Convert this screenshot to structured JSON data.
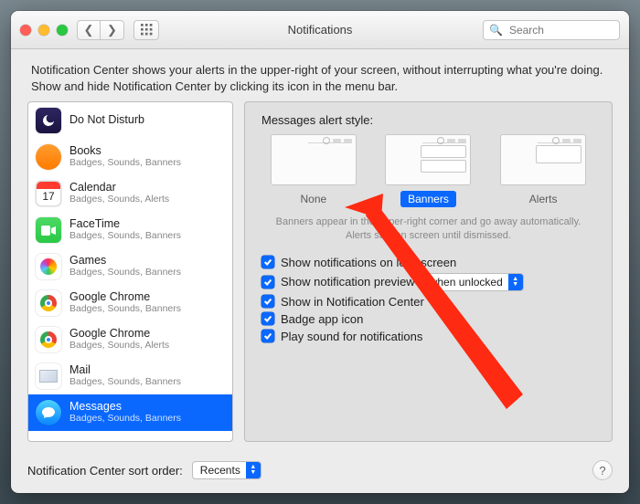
{
  "window": {
    "title": "Notifications"
  },
  "search": {
    "placeholder": "Search"
  },
  "intro": "Notification Center shows your alerts in the upper-right of your screen, without interrupting what you're doing. Show and hide Notification Center by clicking its icon in the menu bar.",
  "sidebar": {
    "items": [
      {
        "name": "Do Not Disturb",
        "sub": ""
      },
      {
        "name": "Books",
        "sub": "Badges, Sounds, Banners"
      },
      {
        "name": "Calendar",
        "sub": "Badges, Sounds, Alerts"
      },
      {
        "name": "FaceTime",
        "sub": "Badges, Sounds, Banners"
      },
      {
        "name": "Games",
        "sub": "Badges, Sounds, Banners"
      },
      {
        "name": "Google Chrome",
        "sub": "Badges, Sounds, Banners"
      },
      {
        "name": "Google Chrome",
        "sub": "Badges, Sounds, Alerts"
      },
      {
        "name": "Mail",
        "sub": "Badges, Sounds, Banners"
      },
      {
        "name": "Messages",
        "sub": "Badges, Sounds, Banners"
      }
    ],
    "selected_index": 8
  },
  "panel": {
    "heading": "Messages alert style:",
    "styles": {
      "none": "None",
      "banners": "Banners",
      "alerts": "Alerts",
      "selected": "banners"
    },
    "desc": "Banners appear in the upper-right corner and go away automatically. Alerts stay on screen until dismissed.",
    "checks": {
      "lock_screen": "Show notifications on lock screen",
      "preview": "Show notification preview",
      "preview_select": "when unlocked",
      "notif_center": "Show in Notification Center",
      "badge": "Badge app icon",
      "sound": "Play sound for notifications"
    }
  },
  "footer": {
    "label": "Notification Center sort order:",
    "sort_select": "Recents"
  },
  "calendar_day": "17"
}
